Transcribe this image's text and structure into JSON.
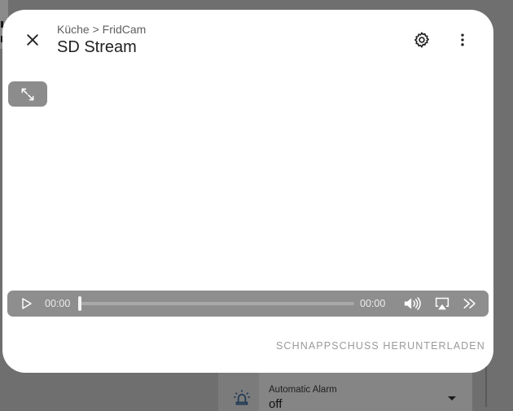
{
  "background": {
    "entity_label": "Automatic Alarm",
    "entity_value": "off",
    "icon": "alarm-light-icon"
  },
  "dialog": {
    "breadcrumb": "Küche > FridCam",
    "title": "SD Stream",
    "icons": {
      "close": "close-icon",
      "settings": "gear-icon",
      "more": "more-vertical-icon"
    },
    "player": {
      "current_time": "00:00",
      "duration": "00:00",
      "progress": 0,
      "icons": [
        "fullscreen-expand-icon",
        "play-icon",
        "volume-icon",
        "airplay-icon",
        "fast-forward-icon"
      ]
    },
    "download_label": "SCHNAPPSCHUSS HERUNTERLADEN"
  }
}
